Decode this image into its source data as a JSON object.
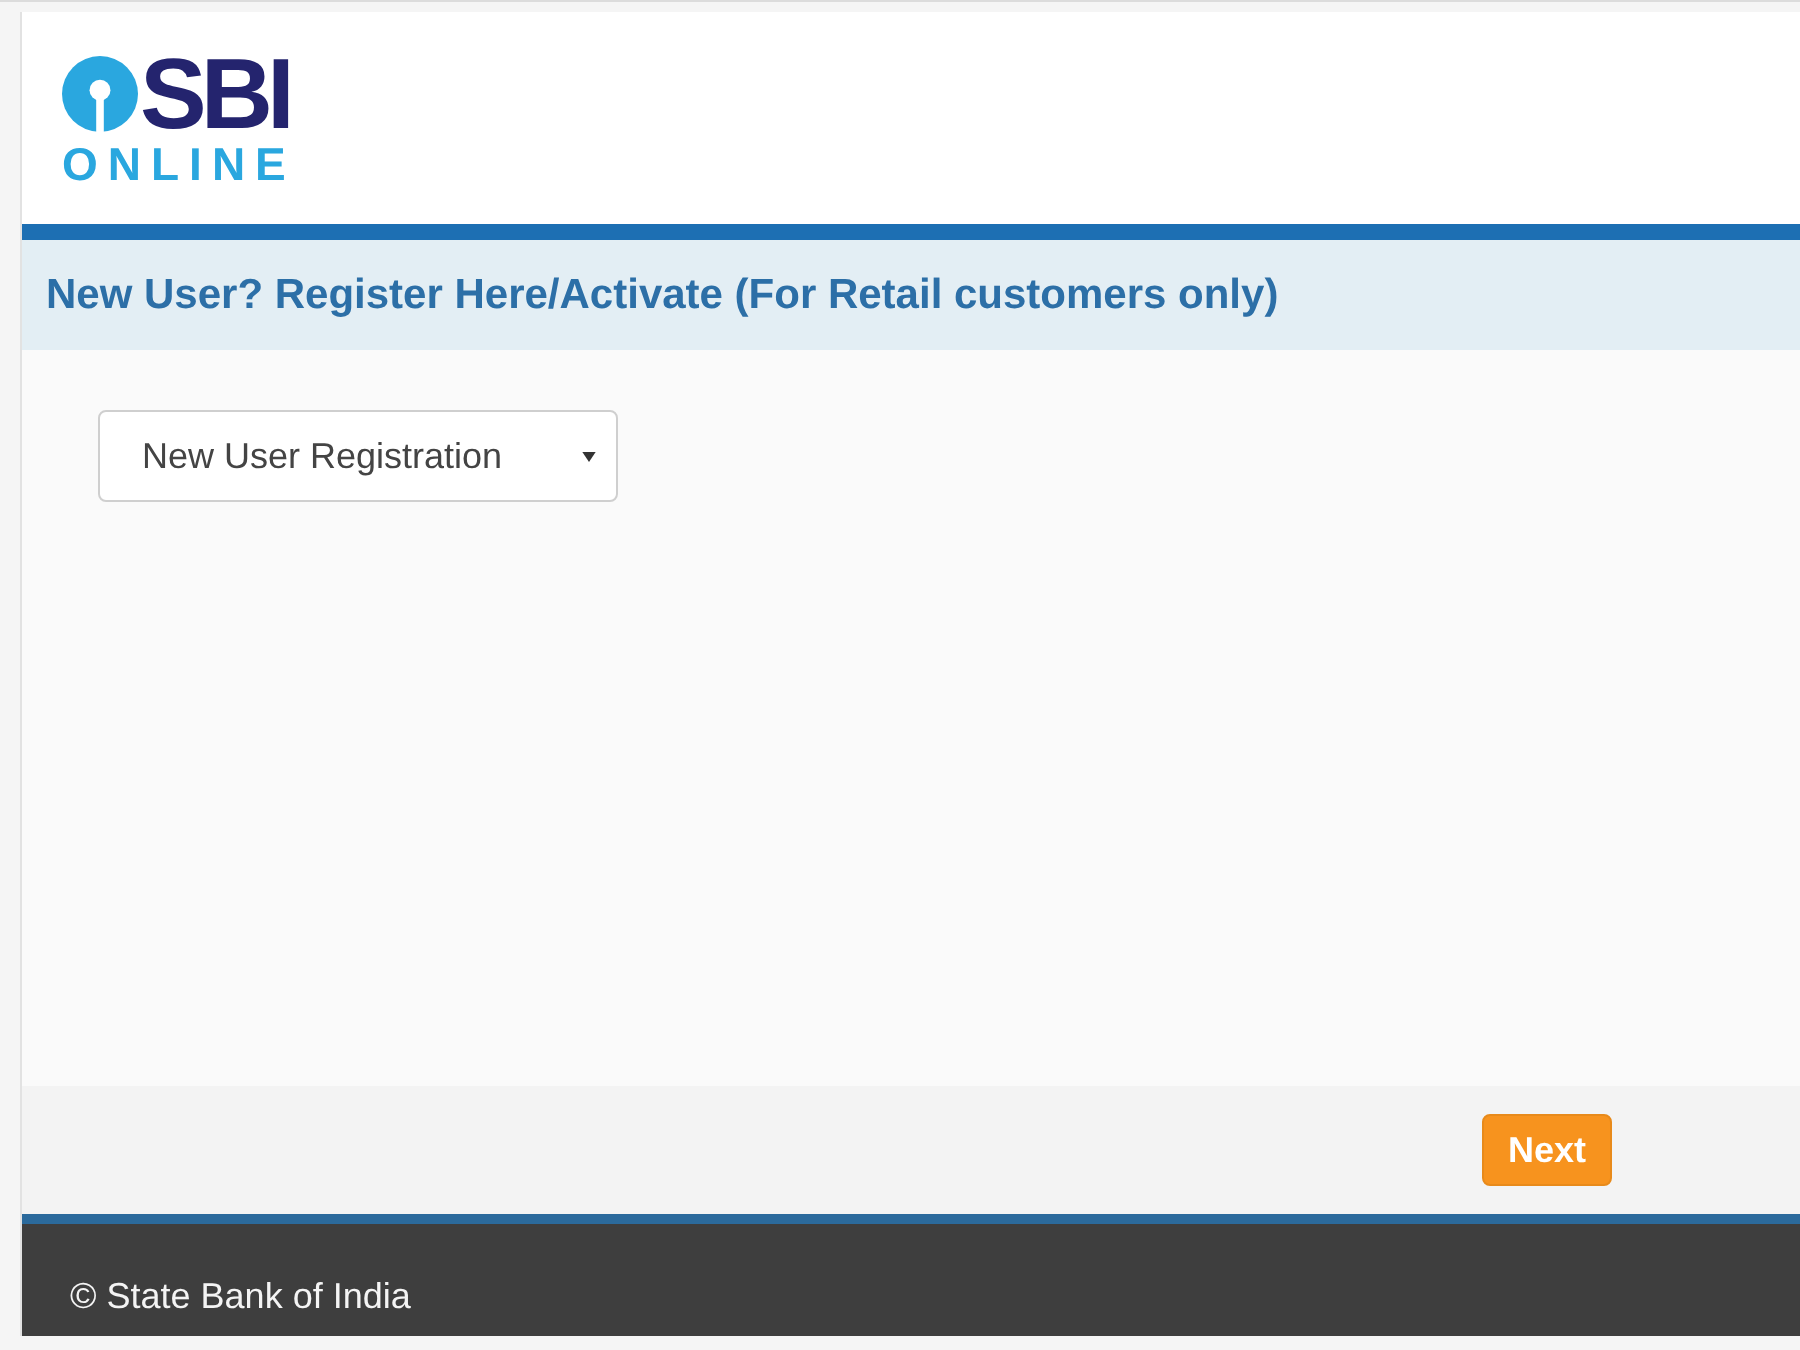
{
  "header": {
    "logo": {
      "wordmark": "SBI",
      "tagline": "ONLINE"
    }
  },
  "title_bar": {
    "title": "New User? Register Here/Activate (For Retail customers only)"
  },
  "form": {
    "registration_type": {
      "value": "New User Registration"
    }
  },
  "actions": {
    "buttons": [
      {
        "label": "Next"
      }
    ]
  },
  "footer": {
    "copyright": "© State Bank of India"
  }
}
